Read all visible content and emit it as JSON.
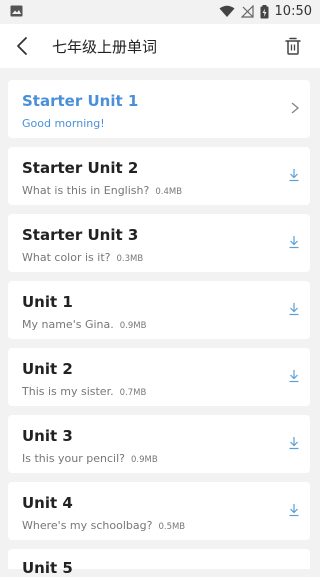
{
  "status": {
    "time": "10:50"
  },
  "header": {
    "title": "七年级上册单词"
  },
  "colors": {
    "accent": "#4a90d9",
    "download": "#5a9fd6"
  },
  "units": [
    {
      "name": "Starter Unit 1",
      "sentence": "Good morning!",
      "size": "",
      "action": "chevron-right-icon"
    },
    {
      "name": "Starter Unit 2",
      "sentence": "What is this in English?",
      "size": "0.4MB",
      "action": "download-icon"
    },
    {
      "name": "Starter Unit 3",
      "sentence": "What color is it?",
      "size": "0.3MB",
      "action": "download-icon"
    },
    {
      "name": "Unit 1",
      "sentence": "My name's Gina.",
      "size": "0.9MB",
      "action": "download-icon"
    },
    {
      "name": "Unit 2",
      "sentence": "This is my sister.",
      "size": "0.7MB",
      "action": "download-icon"
    },
    {
      "name": "Unit 3",
      "sentence": "Is this your pencil?",
      "size": "0.9MB",
      "action": "download-icon"
    },
    {
      "name": "Unit 4",
      "sentence": "Where's my schoolbag?",
      "size": "0.5MB",
      "action": "download-icon"
    },
    {
      "name": "Unit 5",
      "sentence": "",
      "size": "",
      "action": ""
    }
  ]
}
